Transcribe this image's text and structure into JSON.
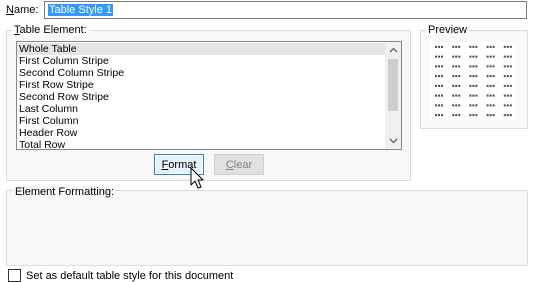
{
  "name": {
    "label_prefix": "N",
    "label_suffix": "ame:",
    "value": "Table Style 1"
  },
  "table_element": {
    "title_prefix": "T",
    "title_suffix": "able Element:",
    "items": [
      "Whole Table",
      "First Column Stripe",
      "Second Column Stripe",
      "First Row Stripe",
      "Second Row Stripe",
      "Last Column",
      "First Column",
      "Header Row",
      "Total Row"
    ],
    "selected": "Whole Table"
  },
  "preview": {
    "title": "Preview",
    "rows": 8,
    "cols": 5
  },
  "buttons": {
    "format_prefix": "F",
    "format_suffix": "ormat",
    "clear_prefix": "C",
    "clear_suffix": "lear"
  },
  "element_formatting": {
    "title": "Element Formatting:"
  },
  "default_option": {
    "label": "Set as default table style for this document",
    "checked": false
  },
  "colors": {
    "selection": "#3399ff",
    "list_selected": "#e5e5e5",
    "format_border": "#3c7fb1",
    "format_bg": "#e5f1fb"
  }
}
